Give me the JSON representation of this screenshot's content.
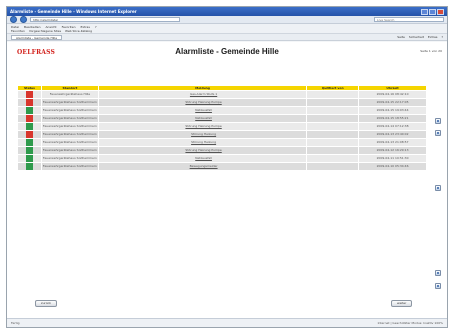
{
  "window": {
    "title": "Alarmliste - Gemeinde Hille - Windows Internet Explorer"
  },
  "browser": {
    "address": "http://alarmliste/",
    "search_placeholder": "Live Search",
    "menu": [
      "Datei",
      "Bearbeiten",
      "Ansicht",
      "Favoriten",
      "Extras",
      "?"
    ],
    "favorites": [
      "Favoriten",
      "Vorgeschlagene Sites",
      "Web Slice-Katalog"
    ],
    "tab_label": "Alarmliste - Gemeinde Hille",
    "right_tools": [
      "Seite",
      "Sicherheit",
      "Extras",
      "?"
    ],
    "status_left": "Fertig",
    "status_right": "Internet | Geschützter Modus: Inaktiv   100%"
  },
  "page": {
    "logo": "OELFRASS",
    "title": "Alarmliste - Gemeinde Hille",
    "top_meta": "Seite 1 von 20"
  },
  "table": {
    "headers": {
      "status": "Status",
      "standort": "Standort",
      "meldung": "Meldung",
      "quittiert": "Quittiert von",
      "uhrzeit": "Uhrzeit"
    },
    "rows": [
      {
        "color": "#d8362d",
        "standort": "Feuerwehrgerätehaus Hille",
        "meldung": "Gas-Alarm Stufe 1",
        "quittiert": "",
        "uhrzeit": "2009-04-16 08:42:10"
      },
      {
        "color": "#d8362d",
        "standort": "Feuerwehrgerätehaus Südhemmern",
        "meldung": "Störung Heizung Pumpe",
        "quittiert": "",
        "uhrzeit": "2009-04-15 22:17:05"
      },
      {
        "color": "#2e9a4c",
        "standort": "Feuerwehrgerätehaus Südhemmern",
        "meldung": "Netzausfall",
        "quittiert": "",
        "uhrzeit": "2009-04-15 19:03:44"
      },
      {
        "color": "#d8362d",
        "standort": "Feuerwehrgerätehaus Südhemmern",
        "meldung": "Netzausfall",
        "quittiert": "",
        "uhrzeit": "2009-04-15 18:55:21"
      },
      {
        "color": "#2e9a4c",
        "standort": "Feuerwehrgerätehaus Südhemmern",
        "meldung": "Störung Heizung Pumpe",
        "quittiert": "",
        "uhrzeit": "2009-04-14 07:12:38"
      },
      {
        "color": "#d8362d",
        "standort": "Feuerwehrgerätehaus Südhemmern",
        "meldung": "Störung Heizung",
        "quittiert": "",
        "uhrzeit": "2009-04-13 23:40:02"
      },
      {
        "color": "#2e9a4c",
        "standort": "Feuerwehrgerätehaus Südhemmern",
        "meldung": "Störung Heizung",
        "quittiert": "",
        "uhrzeit": "2009-04-13 21:08:57"
      },
      {
        "color": "#2e9a4c",
        "standort": "Feuerwehrgerätehaus Südhemmern",
        "meldung": "Störung Heizung Pumpe",
        "quittiert": "",
        "uhrzeit": "2009-04-12 16:29:13"
      },
      {
        "color": "#2e9a4c",
        "standort": "Feuerwehrgerätehaus Südhemmern",
        "meldung": "Netzausfall",
        "quittiert": "",
        "uhrzeit": "2009-04-11 10:51:30"
      },
      {
        "color": "#2e9a4c",
        "standort": "Feuerwehrgerätehaus Südhemmern",
        "meldung": "Bewegungsmelder",
        "quittiert": "",
        "uhrzeit": "2009-04-10 05:34:46"
      }
    ]
  },
  "buttons": {
    "back": "zurück",
    "next": "weiter"
  },
  "icons": {
    "side": [
      "page-icon",
      "page-icon",
      "page-icon",
      "page-icon",
      "page-icon"
    ]
  }
}
